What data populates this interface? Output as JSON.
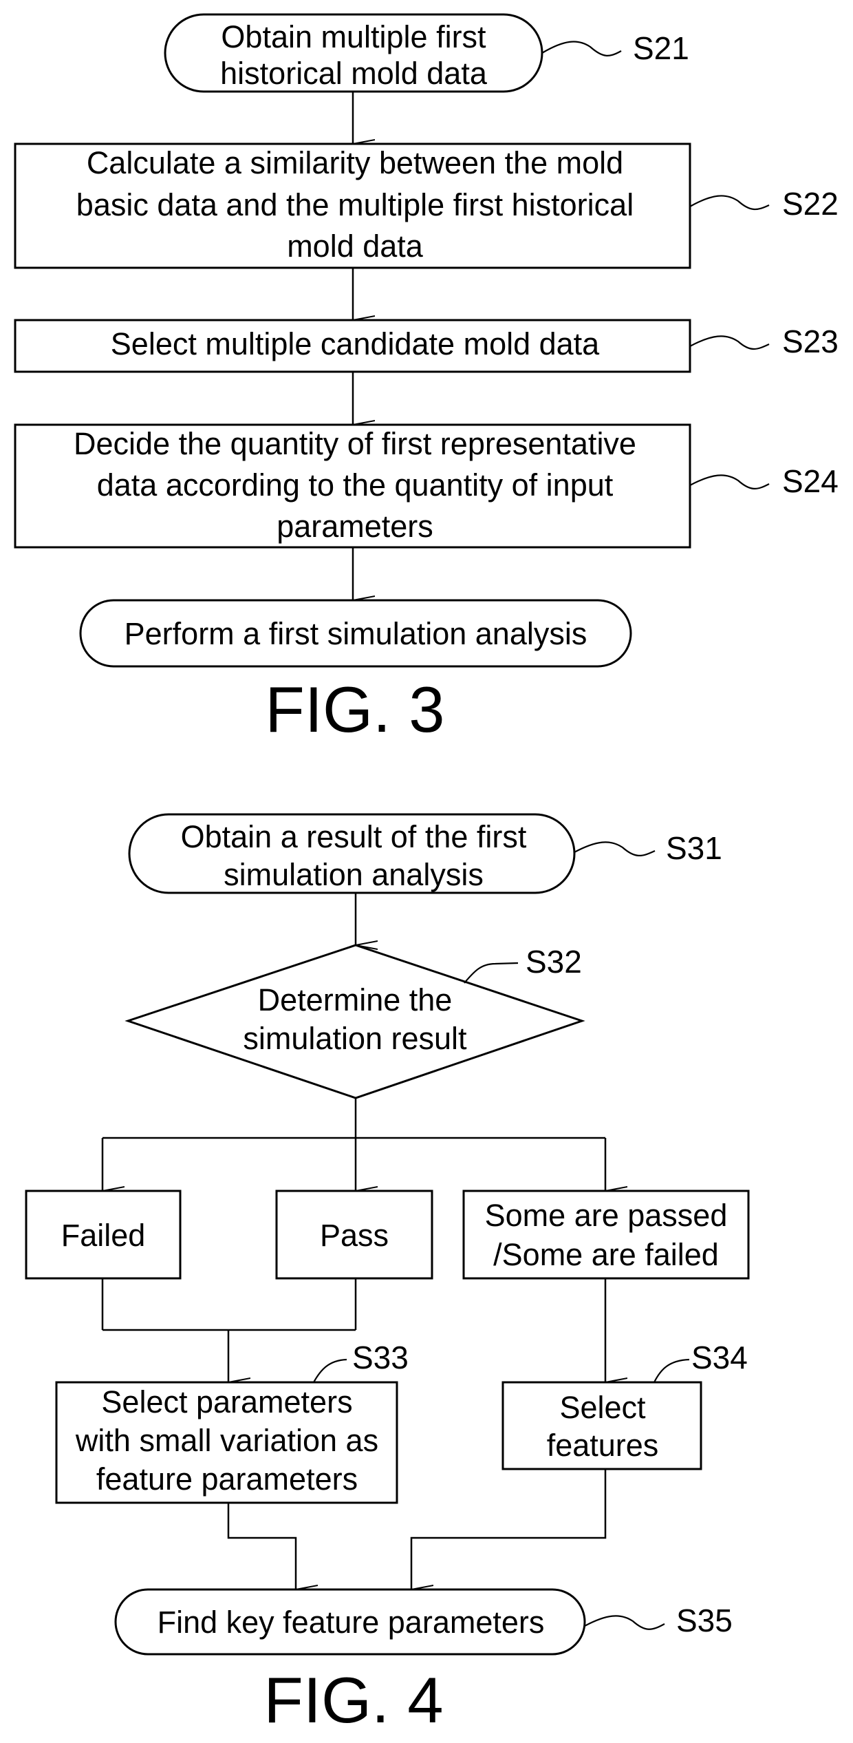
{
  "figures": [
    {
      "title": "FIG. 3",
      "nodes": {
        "s21": {
          "label": "S21",
          "lines": [
            "Obtain multiple first",
            "historical mold data"
          ]
        },
        "s22": {
          "label": "S22",
          "lines": [
            "Calculate a similarity between the mold",
            "basic data and the multiple first historical",
            "mold data"
          ]
        },
        "s23": {
          "label": "S23",
          "lines": [
            "Select multiple candidate mold data"
          ]
        },
        "s24": {
          "label": "S24",
          "lines": [
            "Decide the quantity of first representative",
            "data according to the quantity of input",
            "parameters"
          ]
        },
        "end": {
          "lines": [
            "Perform a first simulation analysis"
          ]
        }
      }
    },
    {
      "title": "FIG. 4",
      "nodes": {
        "s31": {
          "label": "S31",
          "lines": [
            "Obtain a result of the first",
            "simulation analysis"
          ]
        },
        "s32": {
          "label": "S32",
          "lines": [
            "Determine the",
            "simulation result"
          ]
        },
        "failed": {
          "lines": [
            "Failed"
          ]
        },
        "pass": {
          "lines": [
            "Pass"
          ]
        },
        "some": {
          "lines": [
            "Some are passed",
            "/Some are failed"
          ]
        },
        "s33": {
          "label": "S33",
          "lines": [
            "Select parameters",
            "with small variation as",
            "feature parameters"
          ]
        },
        "s34": {
          "label": "S34",
          "lines": [
            "Select",
            "features"
          ]
        },
        "s35": {
          "label": "S35",
          "lines": [
            "Find key feature parameters"
          ]
        }
      }
    }
  ]
}
